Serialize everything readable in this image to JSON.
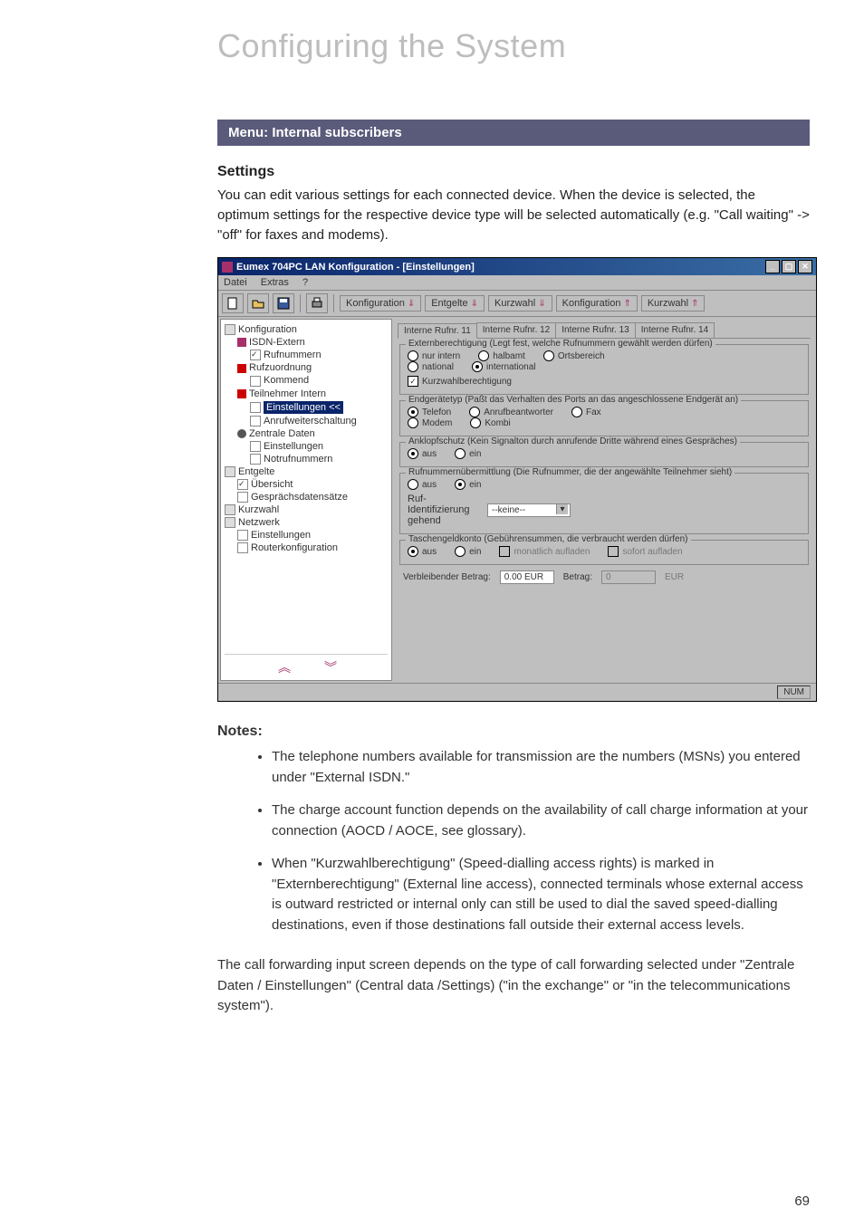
{
  "pageTitle": "Configuring the System",
  "menuBar": "Menu: Internal subscribers",
  "settingsHeading": "Settings",
  "settingsText": "You can edit various settings for each connected device. When the device is selected, the optimum settings for the respective device type will be selected automatically (e.g. \"Call waiting\" -> \"off\" for faxes and modems).",
  "notesHeading": "Notes:",
  "notes": {
    "n1": "The telephone numbers available for transmission are the numbers (MSNs) you entered under \"External ISDN.\"",
    "n2": "The charge account function depends on the availability of call charge information at your connection (AOCD / AOCE, see glossary).",
    "n3": "When \"Kurzwahlberechtigung\" (Speed-dialling access rights) is marked in \"Externberechtigung\" (External line access), connected terminals whose external access is outward restricted or internal only can still be used to dial the saved speed-dialling destinations, even if those destinations fall outside their external access levels."
  },
  "closingPara": "The call forwarding input screen depends on the type of call forwarding selected under \"Zentrale Daten / Einstellungen\" (Central data /Settings) (\"in the exchange\" or \"in the telecommunications system\").",
  "pageNumber": "69",
  "app": {
    "title": "Eumex 704PC LAN Konfiguration - [Einstellungen]",
    "menus": {
      "m1": "Datei",
      "m2": "Extras",
      "m3": "?"
    },
    "toolbar": {
      "konfDown": "Konfiguration",
      "entgelte": "Entgelte",
      "kurzwahlDown": "Kurzwahl",
      "konfUp": "Konfiguration",
      "kurzwahlUp": "Kurzwahl"
    },
    "tree": {
      "t0": "Konfiguration",
      "t1": "ISDN-Extern",
      "t2": "Rufnummern",
      "t3": "Rufzuordnung",
      "t4": "Kommend",
      "t5": "Teilnehmer Intern",
      "t6": "Einstellungen <<",
      "t7": "Anrufweiterschaltung",
      "t8": "Zentrale Daten",
      "t9": "Einstellungen",
      "t10": "Notrufnummern",
      "t11": "Entgelte",
      "t12": "Übersicht",
      "t13": "Gesprächsdatensätze",
      "t14": "Kurzwahl",
      "t15": "Netzwerk",
      "t16": "Einstellungen",
      "t17": "Routerkonfiguration"
    },
    "tabs": {
      "t1": "Interne Rufnr. 11",
      "t2": "Interne Rufnr. 12",
      "t3": "Interne Rufnr. 13",
      "t4": "Interne Rufnr. 14"
    },
    "groups": {
      "extern": {
        "title": "Externberechtigung (Legt fest, welche Rufnummern gewählt werden dürfen)",
        "r1": "nur intern",
        "r2": "halbamt",
        "r3": "Ortsbereich",
        "r4": "national",
        "r5": "international",
        "chk": "Kurzwahlberechtigung"
      },
      "end": {
        "title": "Endgerätetyp (Paßt das Verhalten des Ports an das angeschlossene Endgerät an)",
        "r1": "Telefon",
        "r2": "Anrufbeantworter",
        "r3": "Fax",
        "r4": "Modem",
        "r5": "Kombi"
      },
      "ank": {
        "title": "Anklopfschutz (Kein Signalton durch anrufende Dritte während eines Gespräches)",
        "r1": "aus",
        "r2": "ein"
      },
      "ruf": {
        "title": "Rufnummernübermittlung (Die Rufnummer, die der angewählte Teilnehmer sieht)",
        "r1": "aus",
        "r2": "ein",
        "idLabel": "Ruf-Identifizierung gehend",
        "idValue": "--keine--"
      },
      "tasch": {
        "title": "Taschengeldkonto (Gebührensummen, die verbraucht werden dürfen)",
        "r1": "aus",
        "r2": "ein",
        "c1": "monatlich aufladen",
        "c2": "sofort aufladen",
        "remLabel": "Verbleibender Betrag:",
        "remVal": "0.00 EUR",
        "betLabel": "Betrag:",
        "betVal": "0",
        "betUnit": "EUR"
      }
    },
    "status": "NUM"
  }
}
